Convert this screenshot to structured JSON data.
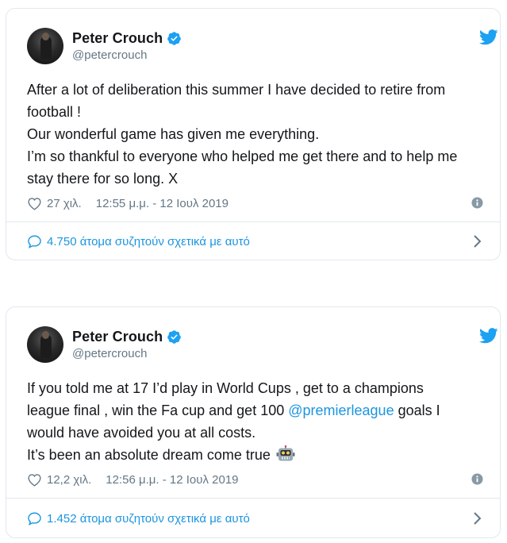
{
  "tweets": [
    {
      "author": {
        "name": "Peter Crouch",
        "handle": "@petercrouch"
      },
      "text_lines": [
        "After a lot of deliberation this summer I have decided to retire from",
        "football !",
        "Our wonderful game has given me everything.",
        "I’m so thankful to everyone who helped me get there and to help me",
        "stay there for so long. X"
      ],
      "likes": "27 χιλ.",
      "timestamp": "12:55 μ.μ. - 12 Ιουλ 2019",
      "discussion": "4.750 άτομα συζητούν σχετικά με αυτό"
    },
    {
      "author": {
        "name": "Peter Crouch",
        "handle": "@petercrouch"
      },
      "text_lines": [
        "If you told me at 17 I’d play in World Cups , get to a champions",
        "league final , win the Fa cup and get 100 ",
        "@premierleague",
        " goals I",
        "would have avoided you at all costs.",
        "It’s been an absolute dream come true "
      ],
      "likes": "12,2 χιλ.",
      "timestamp": "12:56 μ.μ. - 12 Ιουλ 2019",
      "discussion": "1.452 άτομα συζητούν σχετικά με αυτό"
    }
  ],
  "colors": {
    "link": "#1b95e0",
    "verified": "#1da1f2",
    "muted": "#657786",
    "border": "#e1e8ed"
  },
  "icons": [
    "verified-badge-icon",
    "twitter-bird-icon",
    "heart-icon",
    "info-icon",
    "speech-bubble-icon",
    "chevron-right-icon",
    "robot-emoji"
  ]
}
